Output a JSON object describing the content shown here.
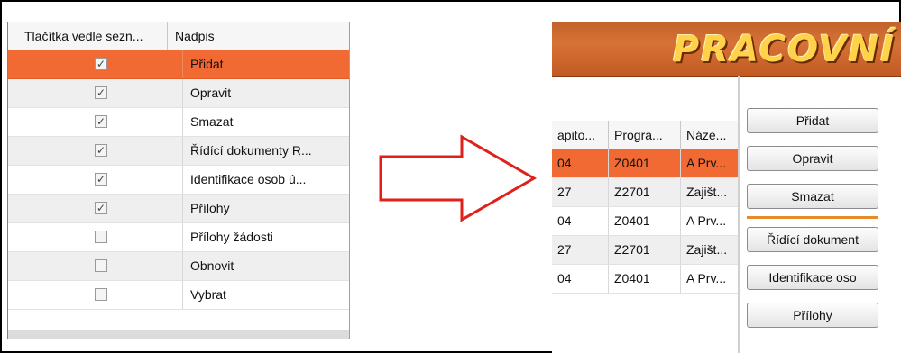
{
  "left_grid": {
    "header": {
      "col1": "Tlačítka vedle sezn...",
      "col2": "Nadpis"
    },
    "rows": [
      {
        "checked": true,
        "label": "Přidat"
      },
      {
        "checked": true,
        "label": "Opravit"
      },
      {
        "checked": true,
        "label": "Smazat"
      },
      {
        "checked": true,
        "label": "Řídící dokumenty R..."
      },
      {
        "checked": true,
        "label": "Identifikace osob ú..."
      },
      {
        "checked": true,
        "label": "Přílohy"
      },
      {
        "checked": false,
        "label": "Přílohy žádosti"
      },
      {
        "checked": false,
        "label": "Obnovit"
      },
      {
        "checked": false,
        "label": "Vybrat"
      }
    ]
  },
  "right_app": {
    "banner_title": "PRACOVNÍ",
    "grid": {
      "headers": [
        "apito...",
        "Progra...",
        "Náze..."
      ],
      "rows": [
        [
          "04",
          "Z0401",
          "A Prv..."
        ],
        [
          "27",
          "Z2701",
          "Zajišt..."
        ],
        [
          "04",
          "Z0401",
          "A Prv..."
        ],
        [
          "27",
          "Z2701",
          "Zajišt..."
        ],
        [
          "04",
          "Z0401",
          "A Prv..."
        ]
      ]
    },
    "buttons": {
      "add": "Přidat",
      "edit": "Opravit",
      "delete": "Smazat",
      "docs": "Řídící dokument",
      "ident": "Identifikace oso",
      "attach": "Přílohy"
    }
  },
  "colors": {
    "accent": "#f26a33",
    "banner": "#c8642c",
    "arrow": "#e0201a"
  }
}
